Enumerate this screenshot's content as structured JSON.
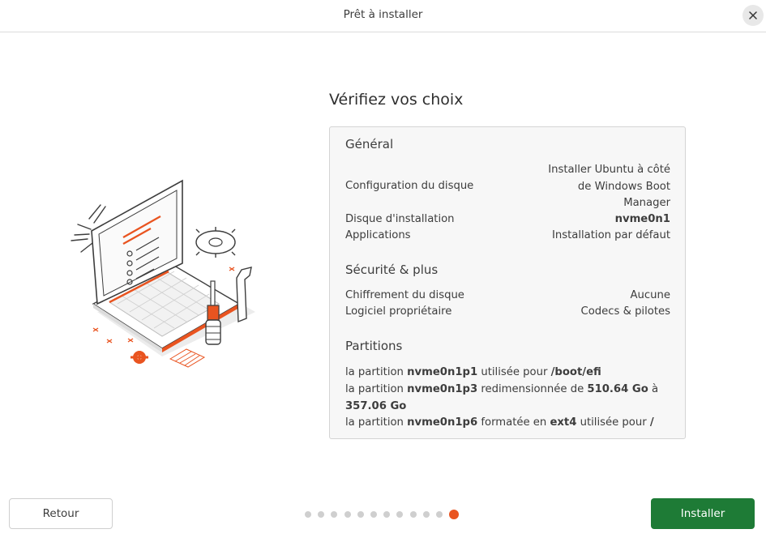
{
  "window": {
    "title": "Prêt à installer"
  },
  "main": {
    "heading": "Vérifiez vos choix",
    "general": {
      "title": "Général",
      "disk_config_label": "Configuration du disque",
      "disk_config_value_line1": "Installer Ubuntu à côté",
      "disk_config_value_line2": "de Windows Boot",
      "disk_config_value_line3": "Manager",
      "install_disk_label": "Disque d'installation",
      "install_disk_value": "nvme0n1",
      "applications_label": "Applications",
      "applications_value": "Installation par défaut"
    },
    "security": {
      "title": "Sécurité & plus",
      "encryption_label": "Chiffrement du disque",
      "encryption_value": "Aucune",
      "proprietary_label": "Logiciel propriétaire",
      "proprietary_value": "Codecs & pilotes"
    },
    "partitions": {
      "title": "Partitions",
      "p1_prefix": "la partition",
      "p1_name": "nvme0n1p1",
      "p1_mid": "utilisée pour",
      "p1_mount": "/boot/efi",
      "p3_prefix": "la partition",
      "p3_name": "nvme0n1p3",
      "p3_mid": "redimensionnée de",
      "p3_from": "510.64 Go",
      "p3_to_word": "à",
      "p3_to": "357.06 Go",
      "p6_prefix": "la partition",
      "p6_name": "nvme0n1p6",
      "p6_mid": "formatée en",
      "p6_fs": "ext4",
      "p6_mid2": "utilisée pour",
      "p6_mount": "/"
    }
  },
  "footer": {
    "back_label": "Retour",
    "install_label": "Installer",
    "progress": {
      "total_steps": 12,
      "current_step": 12
    }
  },
  "colors": {
    "accent": "#e95420",
    "install_button": "#1e7b36"
  },
  "icons": {
    "close": "close-icon",
    "illustration": "laptop-tools-illustration"
  }
}
